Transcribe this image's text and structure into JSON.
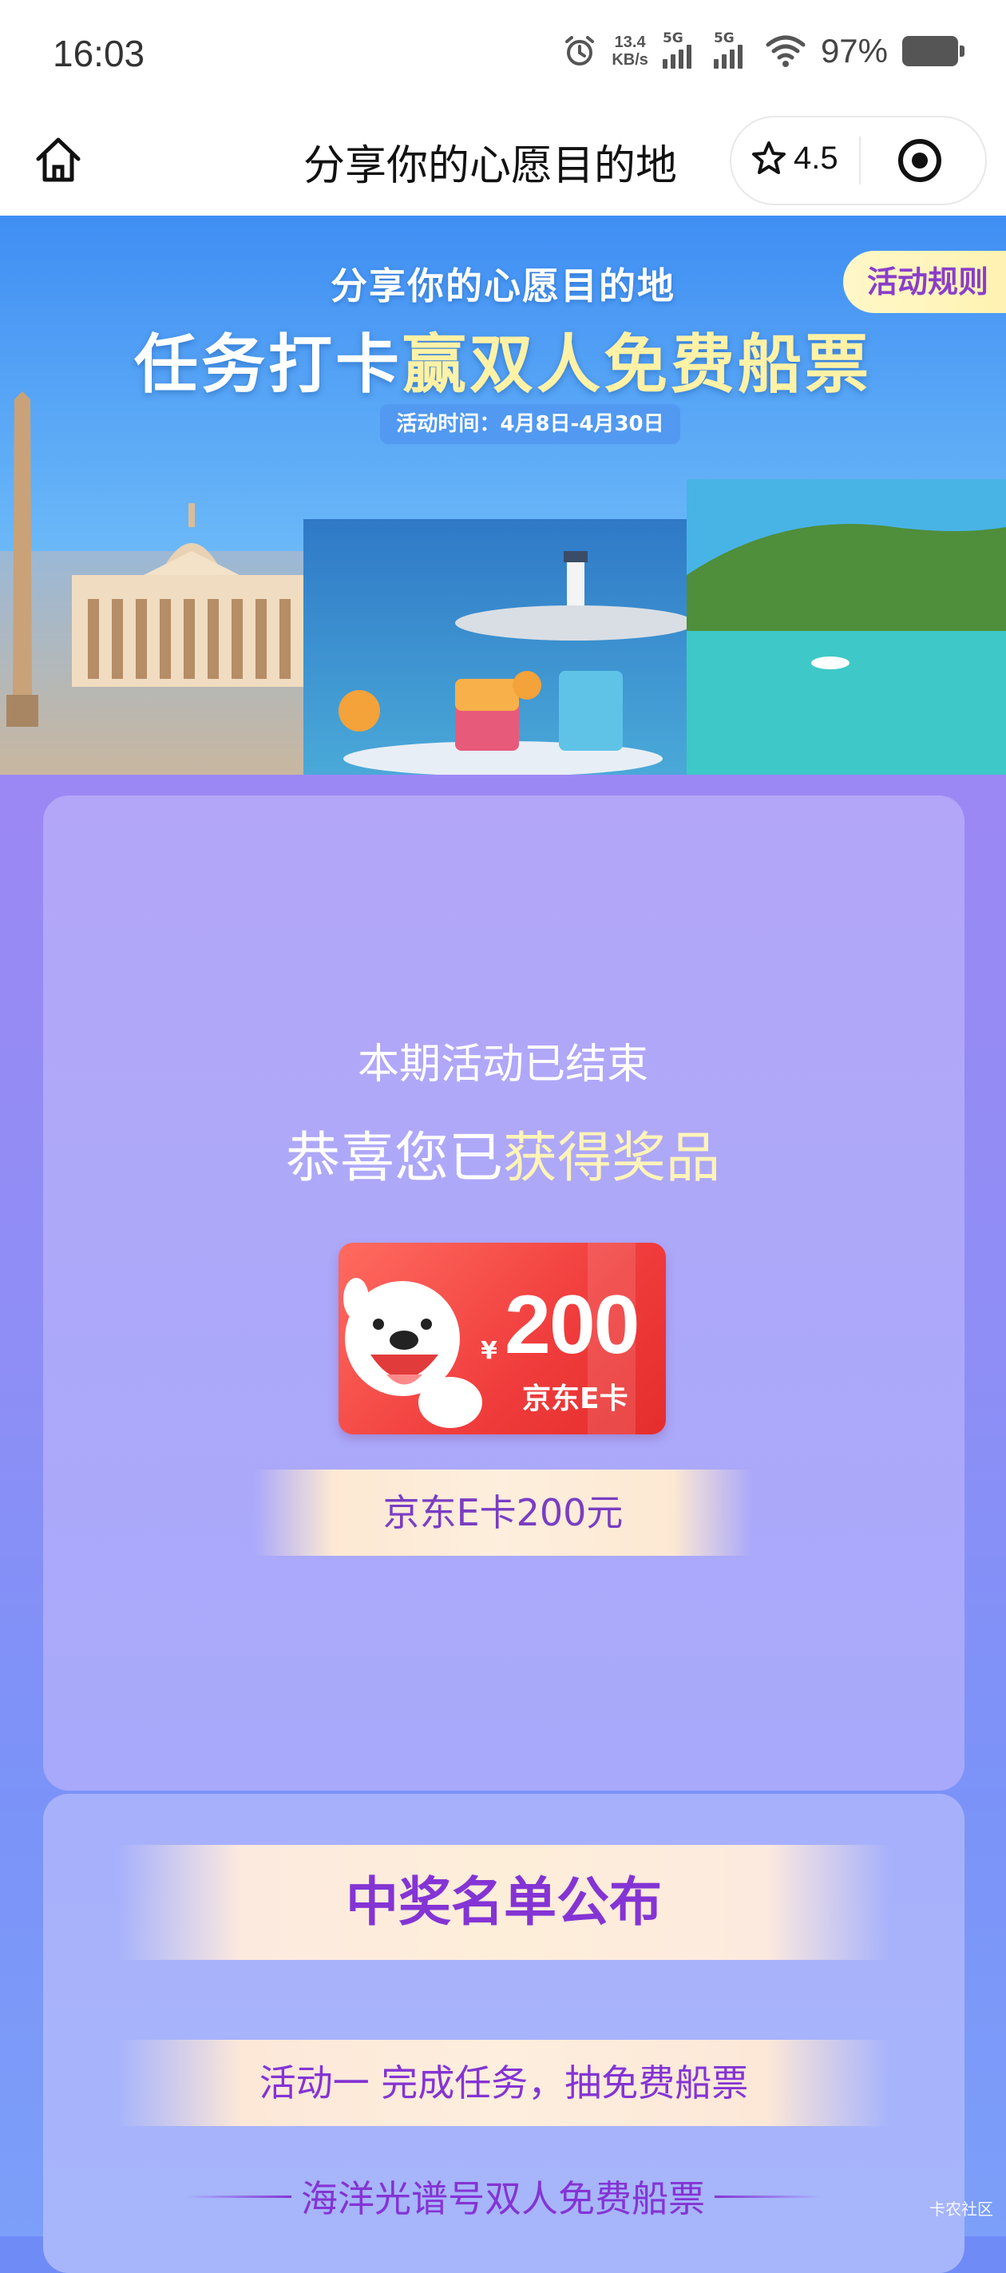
{
  "status_bar": {
    "time": "16:03",
    "net_speed_value": "13.4",
    "net_speed_unit": "KB/s",
    "sim1": "5G",
    "sim2": "5G",
    "battery_percent": "97%"
  },
  "navbar": {
    "title": "分享你的心愿目的地",
    "rating": "4.5",
    "icons": [
      "home-icon",
      "star-icon",
      "target-icon"
    ]
  },
  "banner": {
    "subtitle": "分享你的心愿目的地",
    "title_part1": "任务打卡",
    "title_part2": "赢双人免费船票",
    "date": "活动时间：4月8日-4月30日",
    "rules_button": "活动规则"
  },
  "result_card": {
    "ended_text": "本期活动已结束",
    "congrats_prefix": "恭喜您已",
    "congrats_highlight": "获得奖品",
    "ecard": {
      "currency": "¥",
      "amount": "200",
      "label": "京东E卡"
    },
    "prize_name": "京东E卡200元"
  },
  "winners_card": {
    "title": "中奖名单公布",
    "activity": "活动一  完成任务，抽免费船票",
    "prize_heading": "海洋光谱号双人免费船票"
  },
  "watermark": "卡农社区",
  "colors": {
    "accent_purple": "#8434d4",
    "highlight_yellow": "#fff4b8",
    "ecard_red": "#f03c3c"
  }
}
